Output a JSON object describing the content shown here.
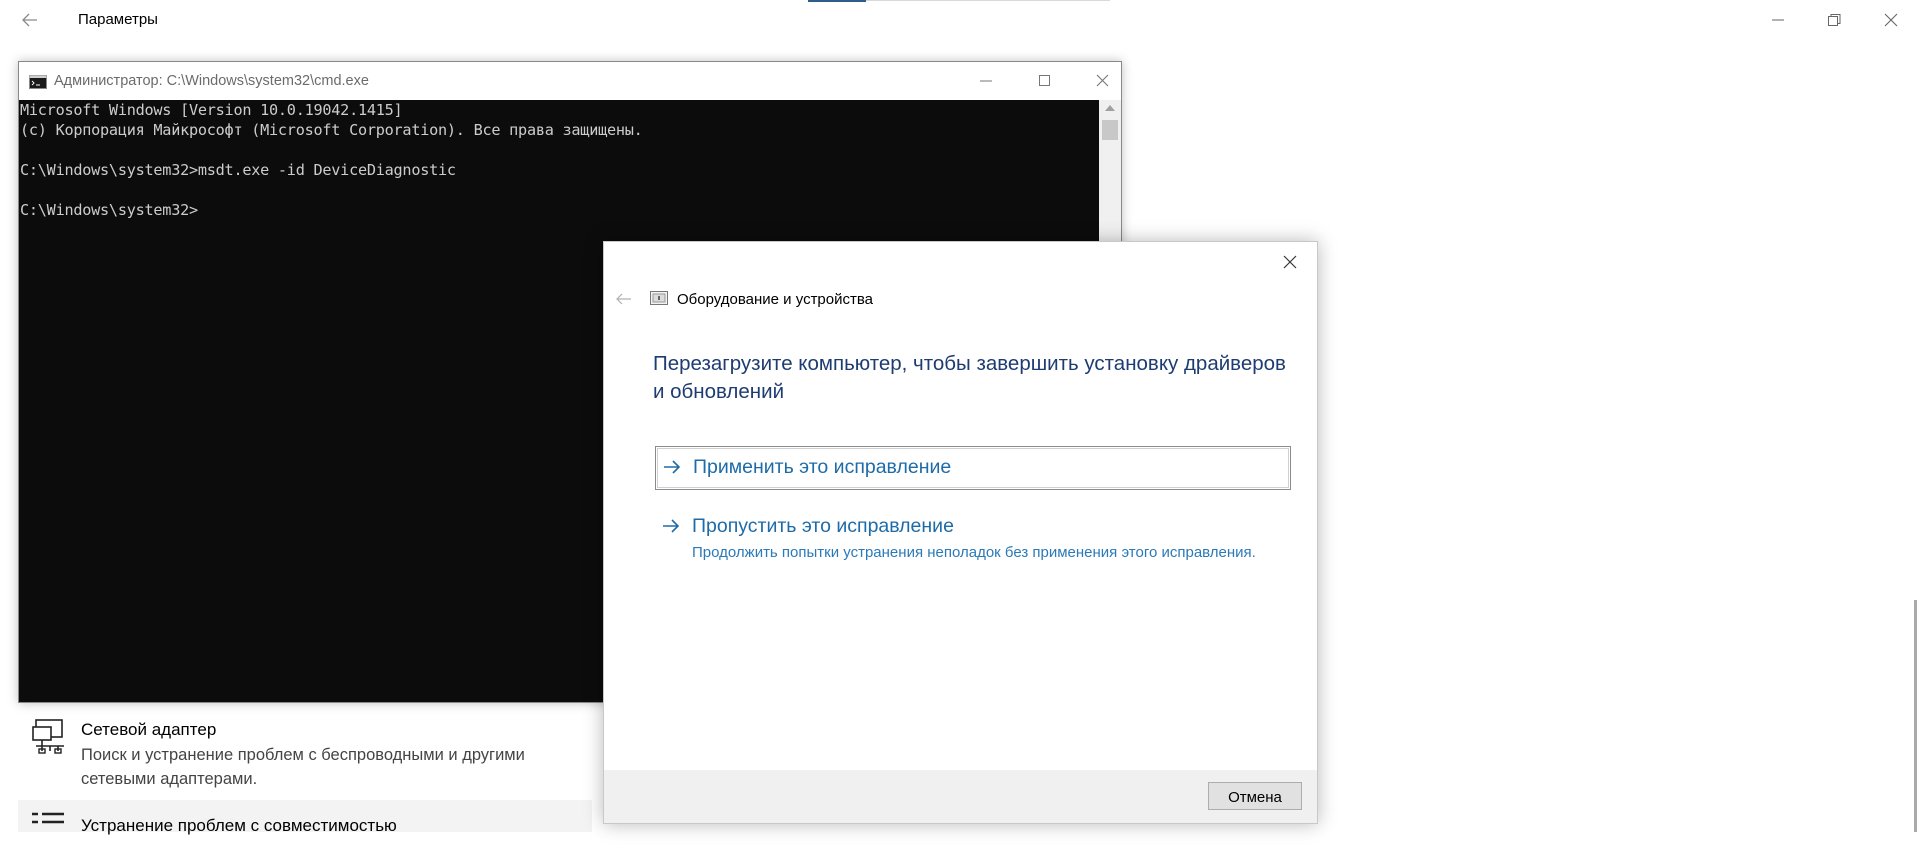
{
  "settings": {
    "title": "Параметры",
    "troubleshooters": [
      {
        "title": "Сетевой адаптер",
        "description": "Поиск и устранение проблем с беспроводными и другими сетевыми адаптерами."
      },
      {
        "title": "Устранение проблем с совместимостью"
      }
    ]
  },
  "cmd": {
    "title": "Администратор: C:\\Windows\\system32\\cmd.exe",
    "lines": [
      "Microsoft Windows [Version 10.0.19042.1415]",
      "(c) Корпорация Майкрософт (Microsoft Corporation). Все права защищены.",
      "",
      "C:\\Windows\\system32>msdt.exe -id DeviceDiagnostic",
      "",
      "C:\\Windows\\system32>"
    ]
  },
  "dialog": {
    "app_title": "Оборудование и устройства",
    "heading": "Перезагрузите компьютер, чтобы завершить установку драйверов и обновлений",
    "apply_label": "Применить это исправление",
    "skip_label": "Пропустить это исправление",
    "skip_description": "Продолжить попытки устранения неполадок без применения этого исправления.",
    "cancel_label": "Отмена"
  },
  "colors": {
    "accent_link": "#1d6ba8",
    "heading_blue": "#1e3c72",
    "console_bg": "#0c0c0c",
    "console_text": "#cccccc"
  }
}
